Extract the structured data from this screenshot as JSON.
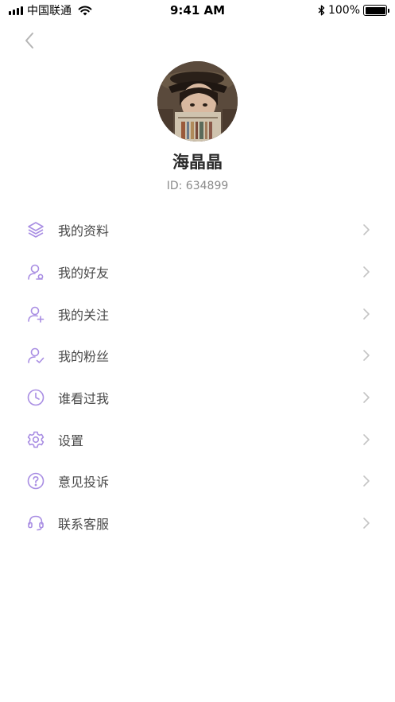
{
  "status_bar": {
    "carrier": "中国联通",
    "time": "9:41 AM",
    "battery": "100%"
  },
  "profile": {
    "name": "海晶晶",
    "id": "ID: 634899"
  },
  "colors": {
    "accent": "#a98ee3",
    "chevron": "#c4c4c4"
  },
  "menu": {
    "items": [
      {
        "label": "我的资料",
        "icon": "layers-icon"
      },
      {
        "label": "我的好友",
        "icon": "user-friend-icon"
      },
      {
        "label": "我的关注",
        "icon": "user-add-icon"
      },
      {
        "label": "我的粉丝",
        "icon": "user-check-icon"
      },
      {
        "label": "谁看过我",
        "icon": "clock-icon"
      },
      {
        "label": "设置",
        "icon": "gear-icon"
      },
      {
        "label": "意见投诉",
        "icon": "question-icon"
      },
      {
        "label": "联系客服",
        "icon": "headset-icon"
      }
    ]
  }
}
